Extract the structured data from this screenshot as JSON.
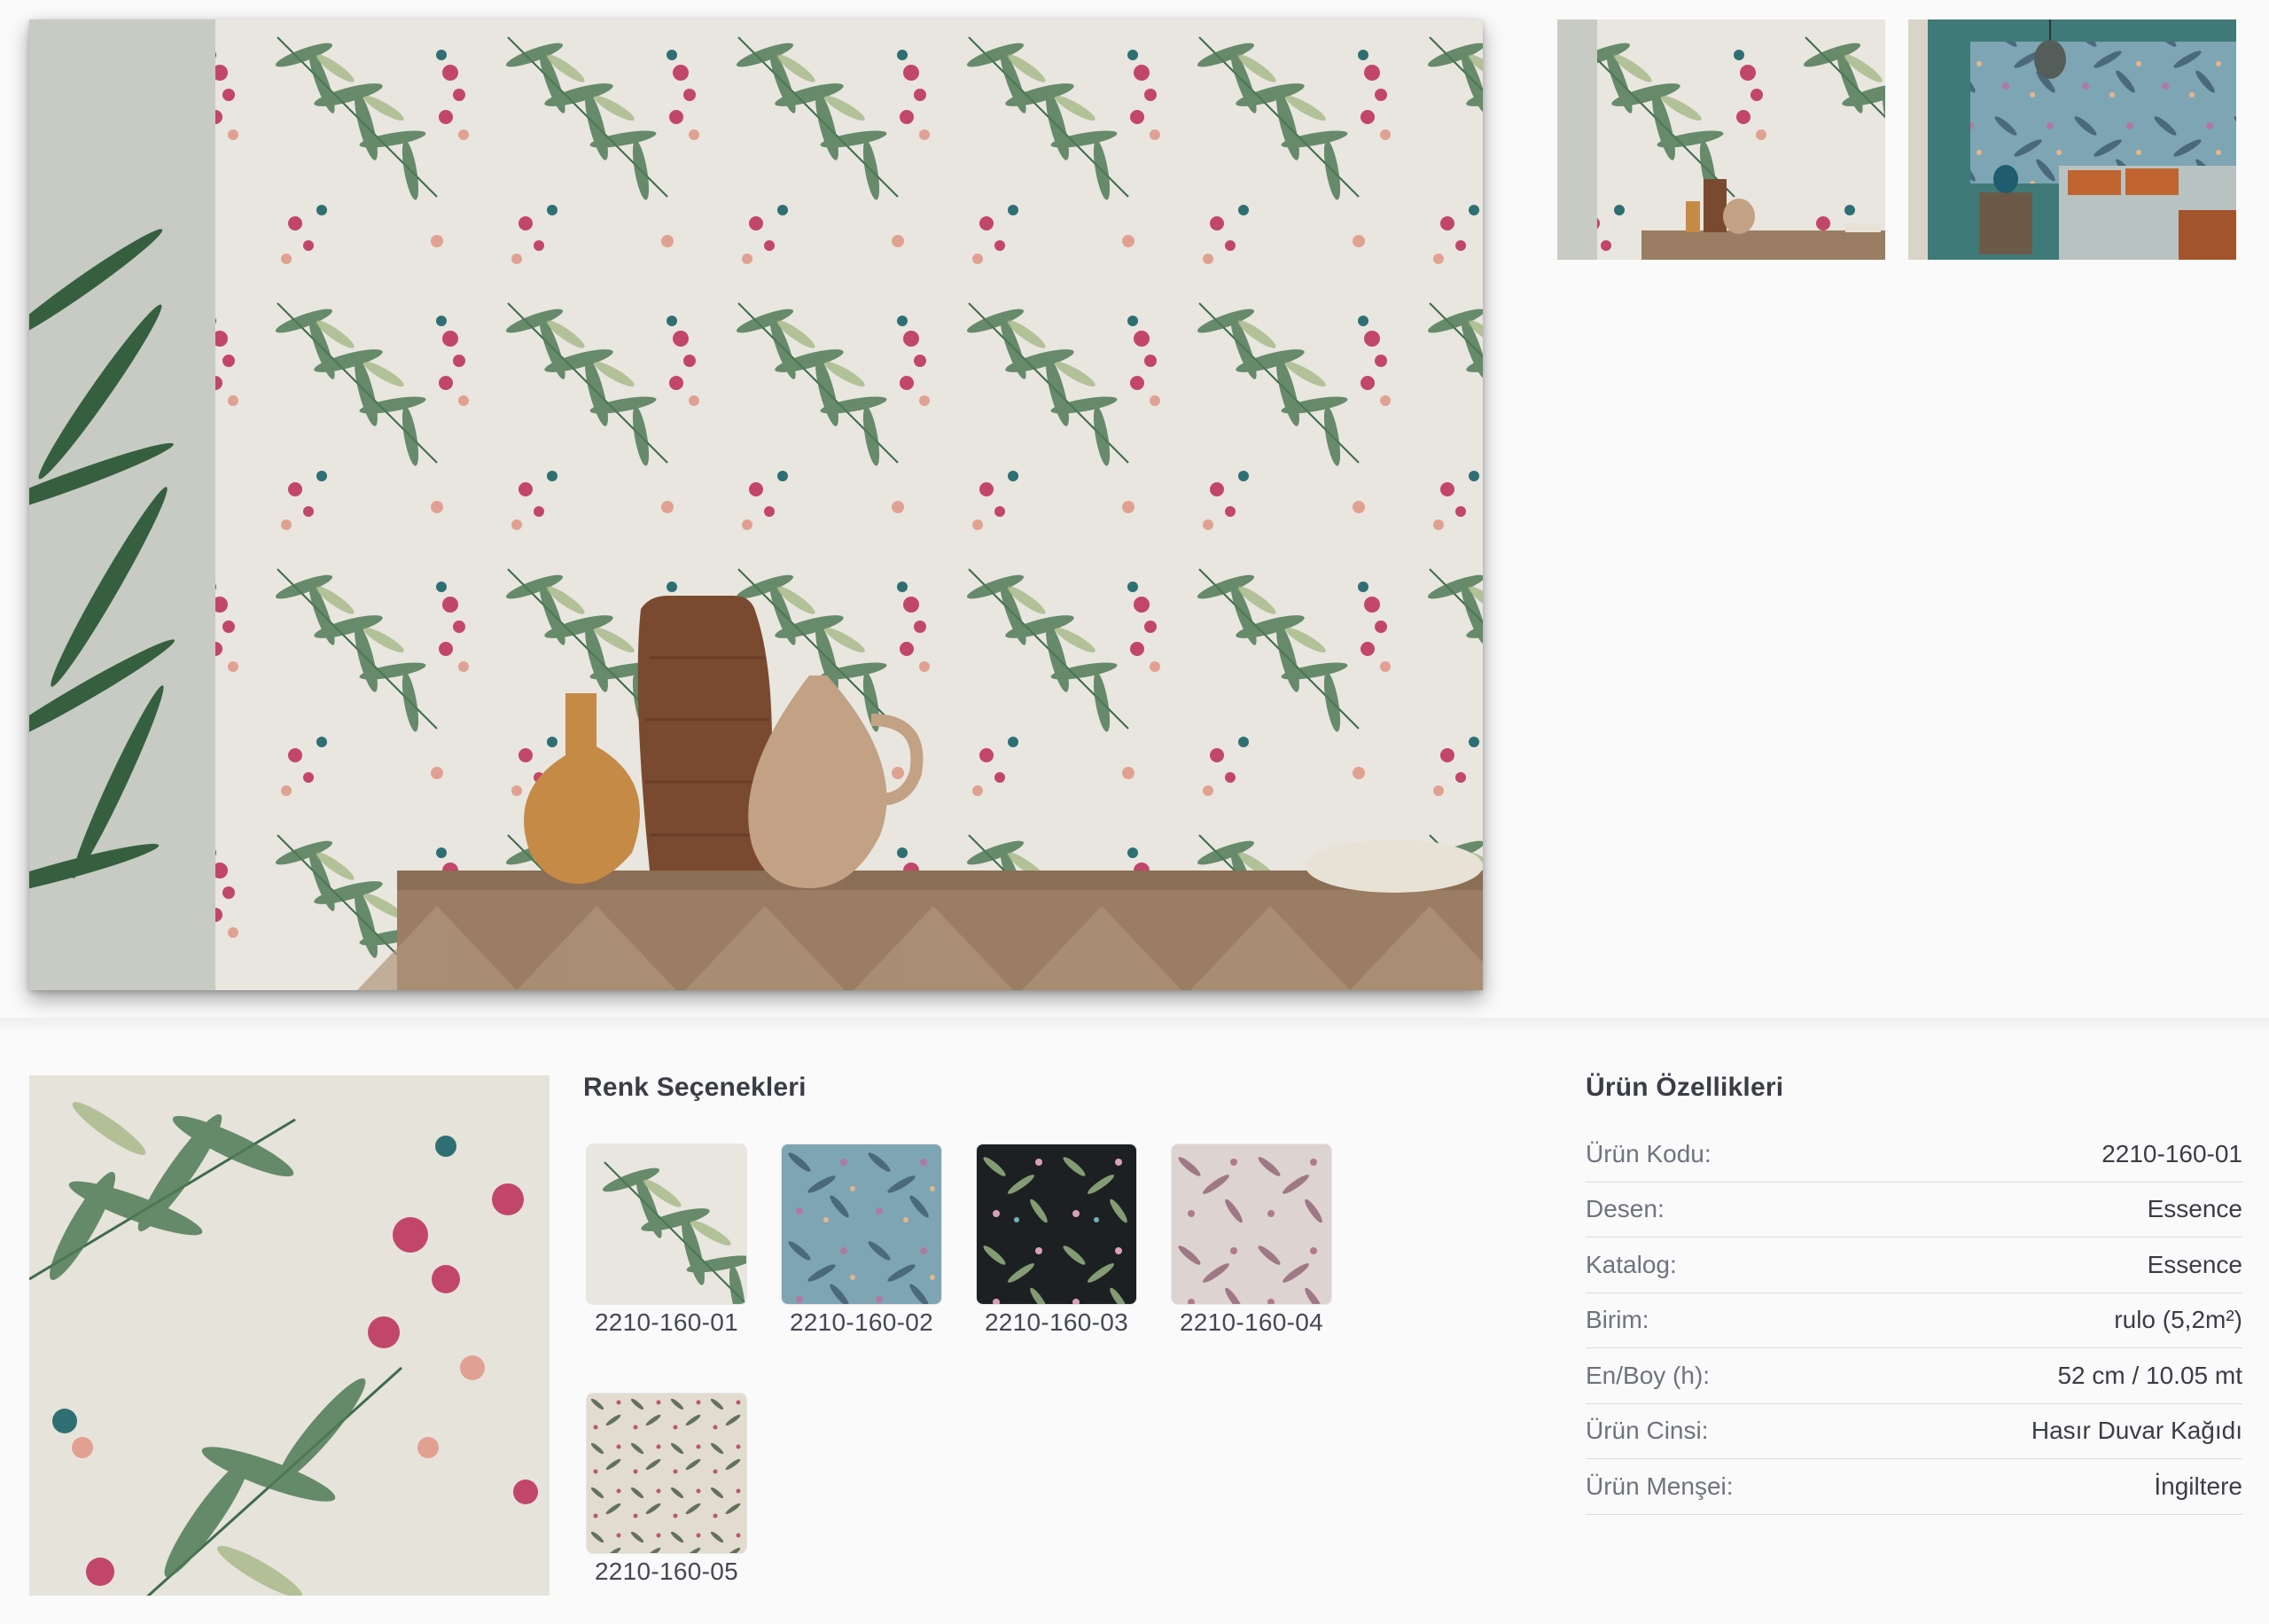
{
  "gallery": {
    "main_image_icon": "floral-wallpaper-room-image",
    "thumbnails": [
      {
        "icon": "wallpaper-room-thumbnail-light"
      },
      {
        "icon": "wallpaper-bedroom-thumbnail-teal"
      }
    ]
  },
  "details": {
    "swatch_icon": "floral-wallpaper-swatch",
    "colors_title": "Renk Seçenekleri",
    "color_options": [
      {
        "code": "2210-160-01",
        "bg": "#e6e3da"
      },
      {
        "code": "2210-160-02",
        "bg": "#7fa6b5"
      },
      {
        "code": "2210-160-03",
        "bg": "#1f2224"
      },
      {
        "code": "2210-160-04",
        "bg": "#ddd2cf"
      },
      {
        "code": "2210-160-05",
        "bg": "#e1dccf"
      }
    ],
    "specs_title": "Ürün Özellikleri",
    "specs": [
      {
        "label": "Ürün Kodu:",
        "value": "2210-160-01"
      },
      {
        "label": "Desen:",
        "value": "Essence"
      },
      {
        "label": "Katalog:",
        "value": "Essence"
      },
      {
        "label": "Birim:",
        "value": "rulo (5,2m²)"
      },
      {
        "label": "En/Boy (h):",
        "value": "52 cm / 10.05 mt"
      },
      {
        "label": "Ürün Cinsi:",
        "value": "Hasır Duvar Kağıdı"
      },
      {
        "label": "Ürün Menşei:",
        "value": "İngiltere"
      }
    ]
  },
  "colors": {
    "page_bg": "#fafafa",
    "leaf_green": "#4f7a55",
    "leaf_light": "#9db07a",
    "flower_pink": "#c2466a",
    "flower_teal": "#2e6f74",
    "wood": "#9a7d62"
  }
}
